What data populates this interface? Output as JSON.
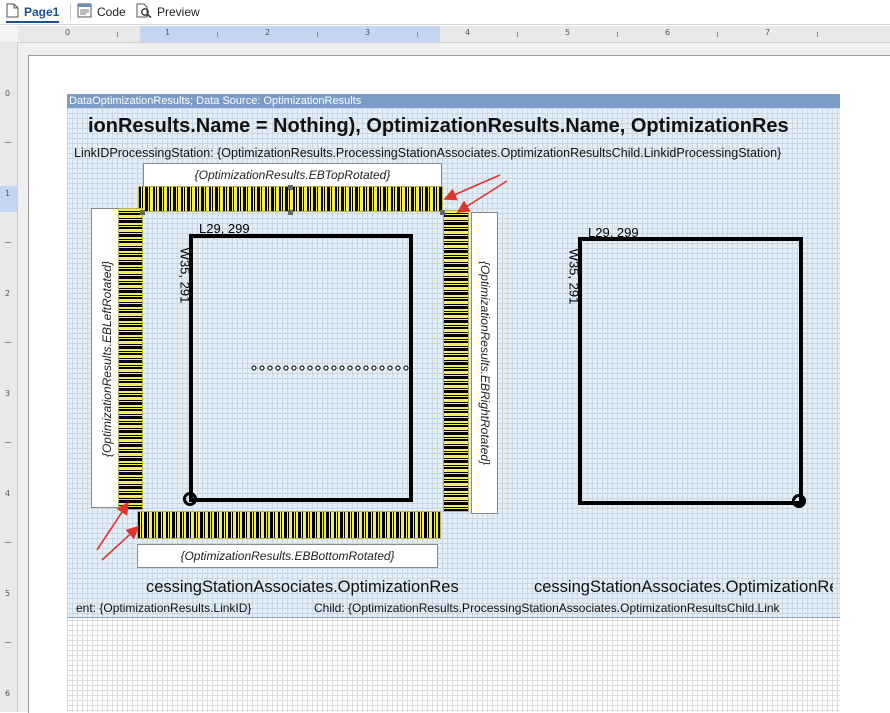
{
  "toolbar": {
    "tabs": [
      {
        "label": "Page1",
        "icon": "page-icon",
        "active": true
      },
      {
        "label": "Code",
        "icon": "code-icon",
        "active": false
      },
      {
        "label": "Preview",
        "icon": "preview-icon",
        "active": false
      }
    ]
  },
  "ruler": {
    "horizontal": [
      "0",
      "1",
      "2",
      "3",
      "4",
      "5",
      "6",
      "7"
    ],
    "vertical": [
      "0",
      "1",
      "2",
      "3",
      "4",
      "5",
      "6"
    ]
  },
  "band": {
    "header": "DataOptimizationResults; Data Source: OptimizationResults"
  },
  "report": {
    "title_expression": "ionResults.Name = Nothing), OptimizationResults.Name, OptimizationRes",
    "link_line": "LinkIDProcessingStation: {OptimizationResults.ProcessingStationAssociates.OptimizationResultsChild.LinkidProcessingStation}",
    "eb_top": "{OptimizationResults.EBTopRotated}",
    "eb_bottom": "{OptimizationResults.EBBottomRotated}",
    "eb_left": "{OptimizationResults.EBLeftRotated}",
    "eb_right": "{OptimizationResults.EBRightRotated}",
    "shape_left": {
      "length_label": "L29, 299",
      "width_label": "W35, 291"
    },
    "shape_right": {
      "length_label": "L29, 299",
      "width_label": "W35, 291"
    },
    "bottom_left_text": "cessingStationAssociates.OptimizationRes",
    "bottom_right_text": "cessingStationAssociates.OptimizationRes",
    "footer_left": "ent: {OptimizationResults.LinkID}",
    "footer_right": "Child: {OptimizationResults.ProcessingStationAssociates.OptimizationResultsChild.Link"
  },
  "colors": {
    "band_header": "#7a9cc6",
    "barcode_highlight": "#f3ec5c",
    "arrow": "#e0332b",
    "active_tab": "#1b4f9c"
  }
}
